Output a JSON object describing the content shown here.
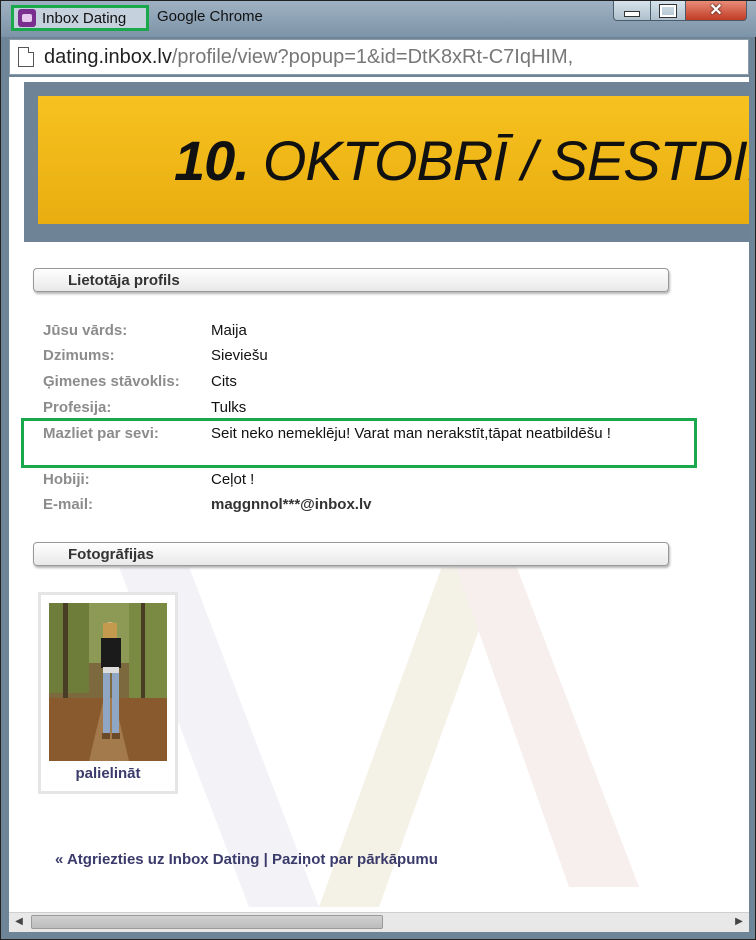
{
  "window": {
    "tab_title": "Inbox Dating",
    "browser_name": "Google Chrome"
  },
  "address_bar": {
    "host": "dating.inbox.lv",
    "path": "/profile/view?popup=1&id=DtK8xRt-C7IqHIM,"
  },
  "banner": {
    "day": "10.",
    "text": "OKTOBRĪ / SESTDIENA"
  },
  "profile": {
    "header": "Lietotāja profils",
    "rows": [
      {
        "label": "Jūsu vārds:",
        "value": "Maija"
      },
      {
        "label": "Dzimums:",
        "value": "Sieviešu"
      },
      {
        "label": "Ģimenes stāvoklis:",
        "value": "Cits"
      },
      {
        "label": "Profesija:",
        "value": "Tulks"
      },
      {
        "label": "Mazliet par sevi:",
        "value": "Seit neko nemeklēju! Varat man nerakstīt,tāpat neatbildēšu !"
      },
      {
        "label": "Hobiji:",
        "value": "Ceļot !"
      },
      {
        "label": "E-mail:",
        "value": "maggnnol***@inbox.lv"
      }
    ]
  },
  "photos": {
    "header": "Fotogrāfijas",
    "enlarge_label": "palielināt"
  },
  "footer": {
    "back_link": "« Atgriezties uz Inbox Dating",
    "separator": "|",
    "report_link": "Paziņot par pārkāpumu"
  },
  "colors": {
    "highlight": "#1aa84c",
    "banner": "#f2b916",
    "link": "#3b3b6b"
  }
}
